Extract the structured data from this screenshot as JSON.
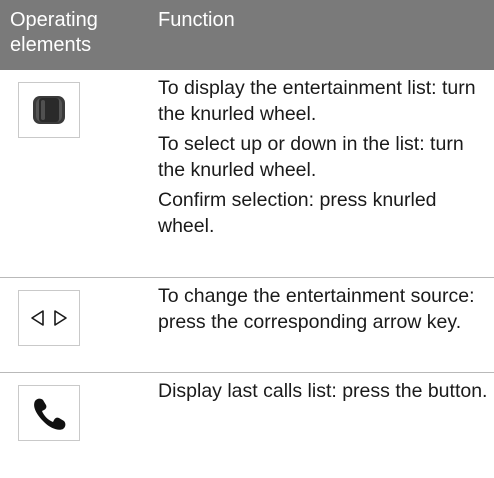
{
  "header": {
    "col1_line1": "Operating",
    "col1_line2": "elements",
    "col2": "Function"
  },
  "rows": [
    {
      "icon": "knurled-wheel-icon",
      "paragraphs": [
        "To display the entertainment list: turn the knurled wheel.",
        "To select up or down in the list: turn the knurled wheel.",
        "Confirm selection: press knurled wheel."
      ]
    },
    {
      "icon": "arrow-keys-icon",
      "paragraphs": [
        "To change the entertainment source: press the corresponding arrow key."
      ]
    },
    {
      "icon": "phone-handset-icon",
      "paragraphs": [
        "Display last calls list: press the button."
      ]
    }
  ],
  "colors": {
    "header_bg": "#7a7a7a",
    "header_text": "#ffffff",
    "divider": "#b9b9b9"
  }
}
